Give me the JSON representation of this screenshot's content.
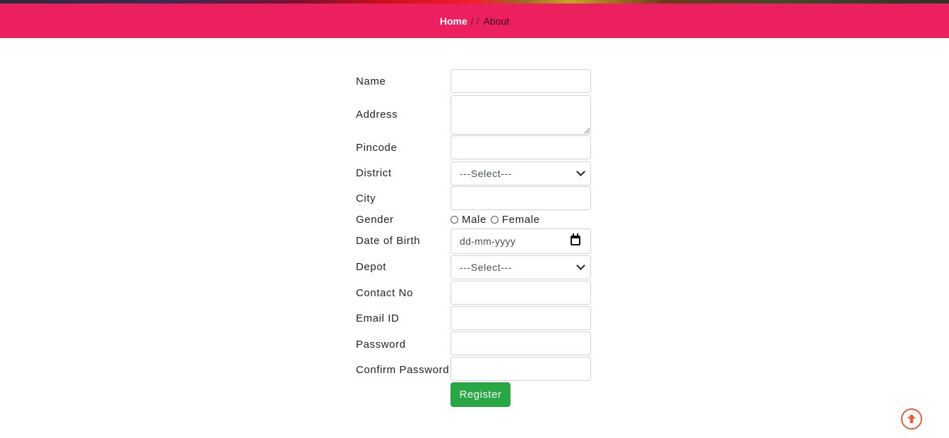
{
  "breadcrumb": {
    "home_label": "Home",
    "separator": "/",
    "current_label": "About"
  },
  "form": {
    "name_label": "Name",
    "address_label": "Address",
    "pincode_label": "Pincode",
    "district_label": "District",
    "district_selected": "---Select---",
    "city_label": "City",
    "gender_label": "Gender",
    "gender_options": [
      "Male",
      "Female"
    ],
    "dob_label": "Date of Birth",
    "dob_placeholder": "dd-mm-yyyy",
    "depot_label": "Depot",
    "depot_selected": "---Select---",
    "contact_label": "Contact No",
    "email_label": "Email ID",
    "password_label": "Password",
    "confirm_password_label": "Confirm Password",
    "register_label": "Register"
  },
  "icons": {
    "calendar": "calendar-icon",
    "scroll_top": "arrow-up-circle-icon",
    "dropdown": "chevron-down-icon"
  },
  "colors": {
    "breadcrumb_bg": "#ec1f5f",
    "register_bg": "#28a745",
    "scroll_top": "#e95c3f"
  }
}
